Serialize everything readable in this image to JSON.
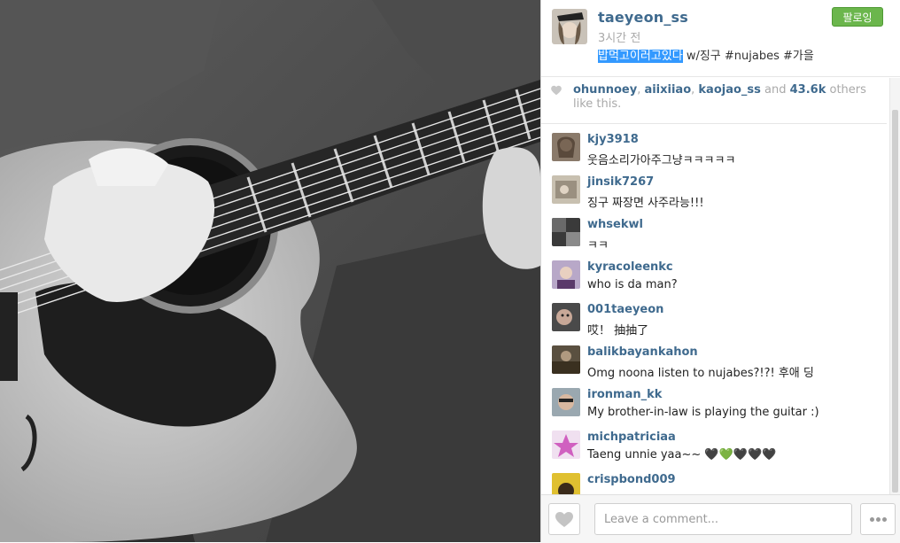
{
  "post": {
    "author": "taeyeon_ss",
    "time": "3시간 전",
    "caption_selected": "밥먹고이러고있다",
    "caption_rest": " w/징구 #nujabes #가을",
    "follow_label": "팔로잉"
  },
  "likes": {
    "users": [
      "ohunnoey",
      "aiixiiao",
      "kaojao_ss"
    ],
    "sep": ", ",
    "and": " and ",
    "count": "43.6k",
    "suffix": " others like this."
  },
  "comments": [
    {
      "user": "kjy3918",
      "text": "웃음소리가아주그냥ㅋㅋㅋㅋㅋ"
    },
    {
      "user": "jinsik7267",
      "text": "징구 짜장면 사주라능!!!"
    },
    {
      "user": "whsekwl",
      "text": "ㅋㅋ"
    },
    {
      "user": "kyracoleenkc",
      "text": "who is da man?"
    },
    {
      "user": "001taeyeon",
      "text": "哎！ 抽抽了"
    },
    {
      "user": "balikbayankahon",
      "text": "Omg noona listen to nujabes?!?! 후애 딩"
    },
    {
      "user": "ironman_kk",
      "text": "My brother-in-law is playing the guitar :)"
    },
    {
      "user": "michpatriciaa",
      "text": "Taeng unnie yaa~~ 🖤💚🖤🖤🖤"
    },
    {
      "user": "crispbond009",
      "text": ""
    }
  ],
  "footer": {
    "comment_placeholder": "Leave a comment..."
  },
  "colors": {
    "username": "#3f6a8e",
    "follow_green": "#6bb64c",
    "muted": "#a9a9a9"
  },
  "icons": [
    "heart-icon",
    "more-dots-icon"
  ]
}
